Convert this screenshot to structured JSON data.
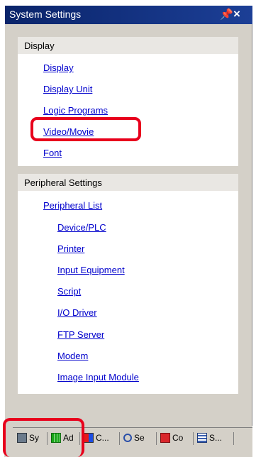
{
  "window": {
    "title": "System Settings",
    "pin_glyph": "੪",
    "close_glyph": "×"
  },
  "display_group": {
    "header": "Display",
    "items": [
      "Display",
      "Display Unit",
      "Logic Programs",
      "Video/Movie",
      "Font"
    ]
  },
  "peripheral_group": {
    "header": "Peripheral Settings",
    "top_item": "Peripheral List",
    "items": [
      "Device/PLC",
      "Printer",
      "Input Equipment",
      "Script",
      "I/O Driver",
      "FTP Server",
      "Modem",
      "Image Input Module"
    ]
  },
  "tabs": [
    {
      "label": "Sy",
      "icon": "system-settings-icon"
    },
    {
      "label": "Ad",
      "icon": "address-icon"
    },
    {
      "label": "C...",
      "icon": "color-palette-icon"
    },
    {
      "label": "Se",
      "icon": "search-icon"
    },
    {
      "label": "Co",
      "icon": "common-icon"
    },
    {
      "label": "S...",
      "icon": "screen-list-icon"
    }
  ],
  "colors": {
    "titlebar": "#0a246a",
    "link": "#0000cc",
    "highlight": "#e8001c"
  }
}
